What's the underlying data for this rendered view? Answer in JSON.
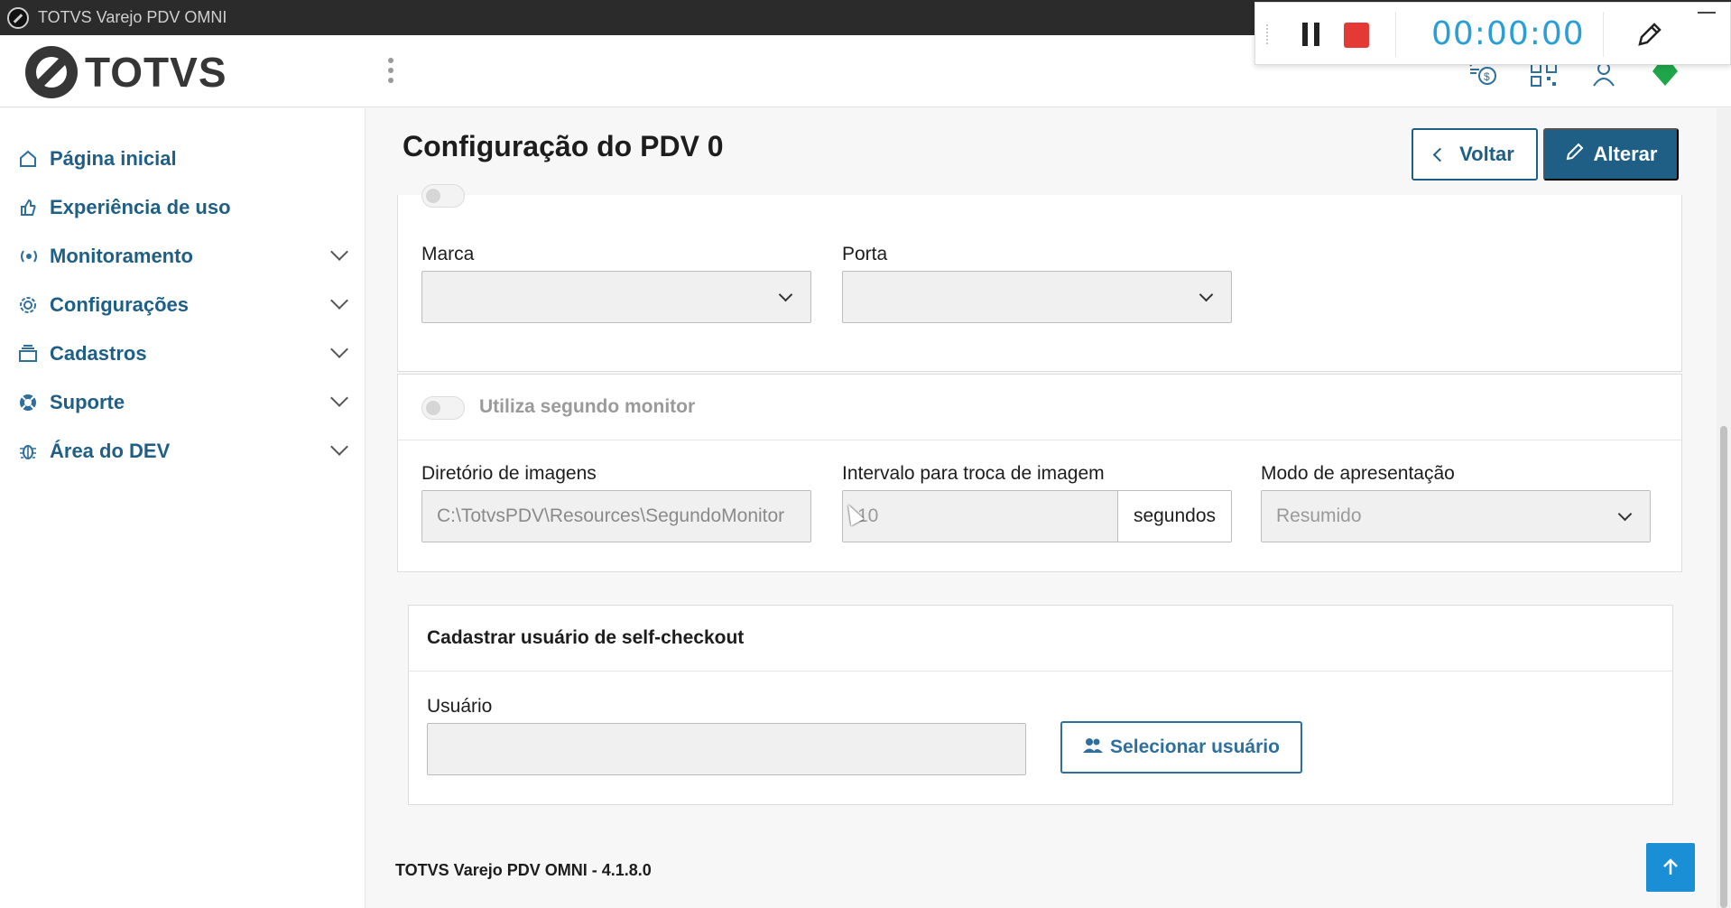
{
  "window": {
    "title": "TOTVS Varejo PDV OMNI"
  },
  "header": {
    "logo_text": "TOTVS",
    "icons": [
      "cash-register-icon",
      "qr-code-icon",
      "user-icon",
      "status-diamond-icon"
    ]
  },
  "recorder": {
    "timer": "00:00:00"
  },
  "sidebar": {
    "items": [
      {
        "label": "Página inicial",
        "icon": "home-icon",
        "expandable": false
      },
      {
        "label": "Experiência de uso",
        "icon": "thumbs-up-icon",
        "expandable": false
      },
      {
        "label": "Monitoramento",
        "icon": "broadcast-icon",
        "expandable": true
      },
      {
        "label": "Configurações",
        "icon": "gear-icon",
        "expandable": true
      },
      {
        "label": "Cadastros",
        "icon": "cards-icon",
        "expandable": true
      },
      {
        "label": "Suporte",
        "icon": "lifebuoy-icon",
        "expandable": true
      },
      {
        "label": "Área do DEV",
        "icon": "bug-icon",
        "expandable": true
      }
    ]
  },
  "page": {
    "title": "Configuração do PDV 0",
    "back_label": "Voltar",
    "edit_label": "Alterar"
  },
  "printer_section": {
    "marca_label": "Marca",
    "marca_value": "",
    "porta_label": "Porta",
    "porta_value": ""
  },
  "second_monitor": {
    "toggle_label": "Utiliza segundo monitor",
    "toggle_on": false,
    "dir_label": "Diretório de imagens",
    "dir_value": "C:\\TotvsPDV\\Resources\\SegundoMonitor",
    "interval_label": "Intervalo para troca de imagem",
    "interval_value": "10",
    "interval_unit": "segundos",
    "mode_label": "Modo de apresentação",
    "mode_value": "Resumido"
  },
  "self_checkout": {
    "title": "Cadastrar usuário de self-checkout",
    "user_label": "Usuário",
    "user_value": "",
    "select_button": "Selecionar usuário"
  },
  "footer": {
    "version": "TOTVS Varejo PDV OMNI - 4.1.8.0"
  },
  "colors": {
    "primary": "#1f5f86",
    "accent": "#1b8fd6",
    "stop": "#e53935",
    "timer": "#2a9fd6"
  }
}
